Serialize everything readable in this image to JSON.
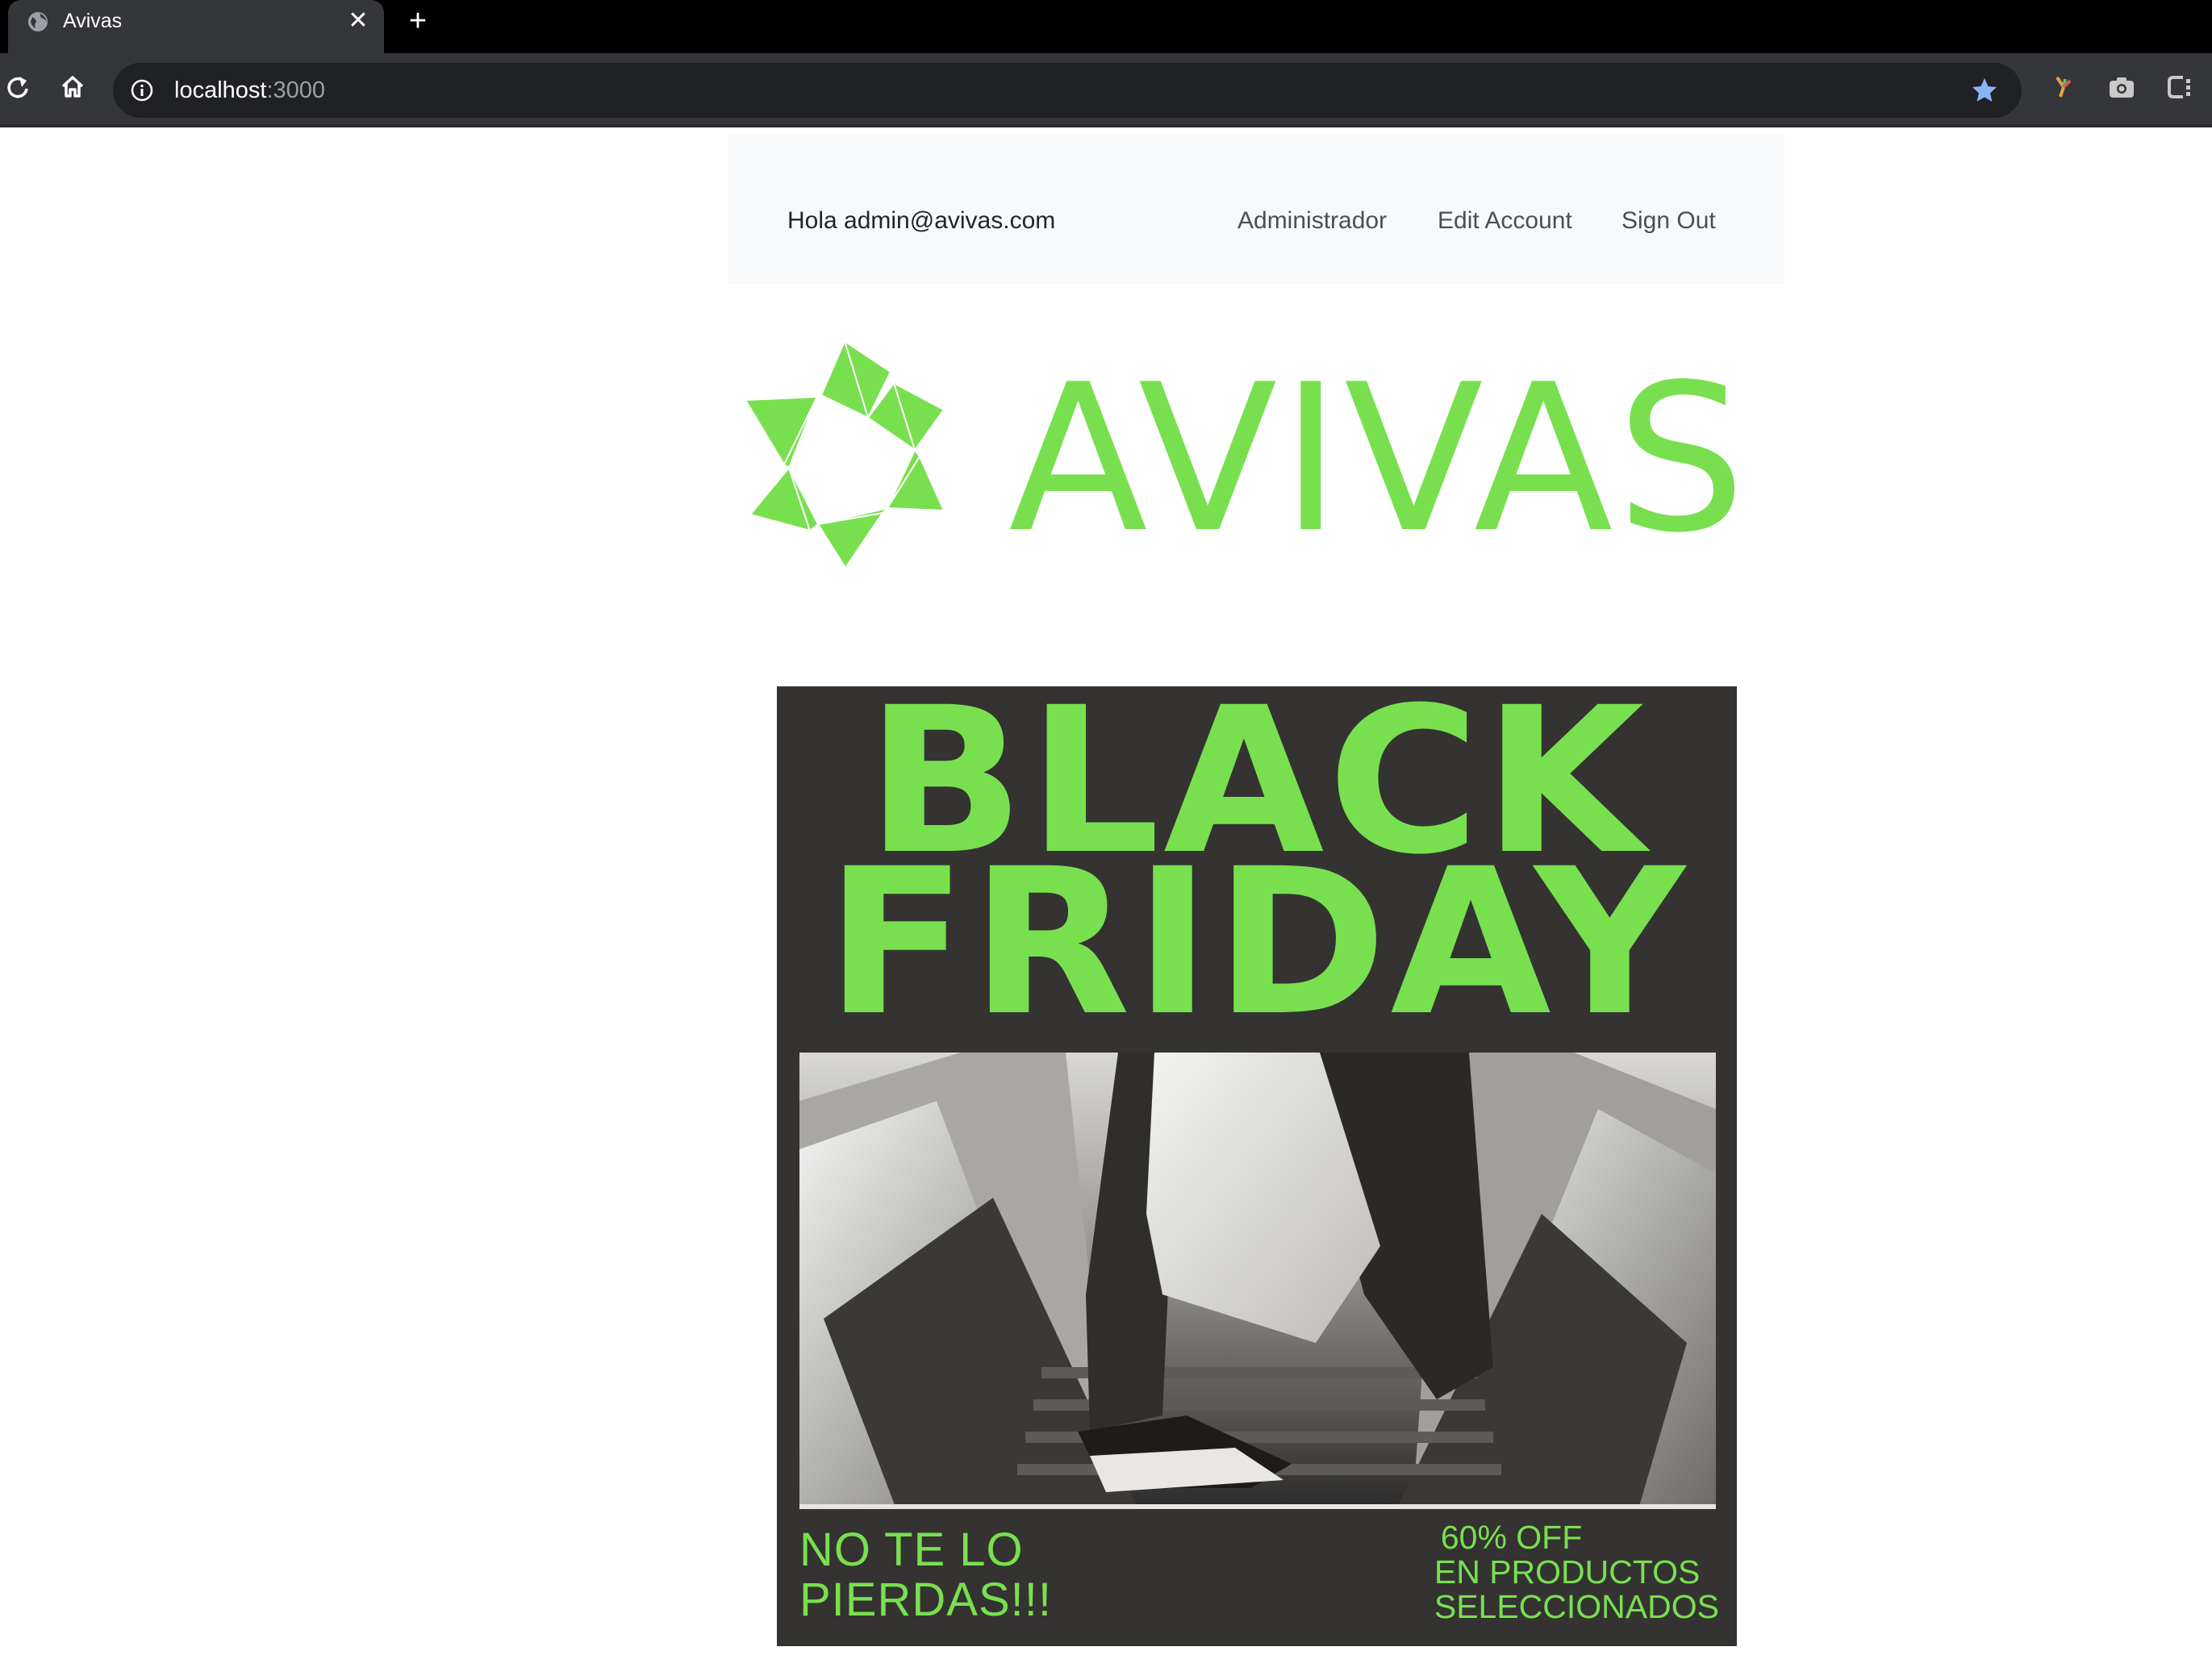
{
  "browser": {
    "tab_title": "Avivas",
    "tab_close": "✕",
    "new_tab": "+",
    "url_host": "localhost",
    "url_port": ":3000",
    "icons": [
      "globe-icon",
      "reload-icon",
      "home-icon",
      "site-info-icon",
      "bookmark-star-icon",
      "extension-icon",
      "camera-icon",
      "extension-c-icon"
    ],
    "star_color": "#8ab4f8"
  },
  "navbar": {
    "greeting": "Hola admin@avivas.com",
    "links": [
      "Administrador",
      "Edit Account",
      "Sign Out"
    ]
  },
  "logo": {
    "text": "AVIVAS",
    "color": "#78e04f"
  },
  "banner": {
    "headline_1": "BLACK",
    "headline_2": "FRIDAY",
    "promo_left_1": "NO TE LO",
    "promo_left_2": "PIERDAS!!!",
    "promo_right_1": "60% OFF",
    "promo_right_2": "EN PRODUCTOS",
    "promo_right_3": "SELECCIONADOS",
    "background": "#343331",
    "accent": "#78e04f"
  }
}
